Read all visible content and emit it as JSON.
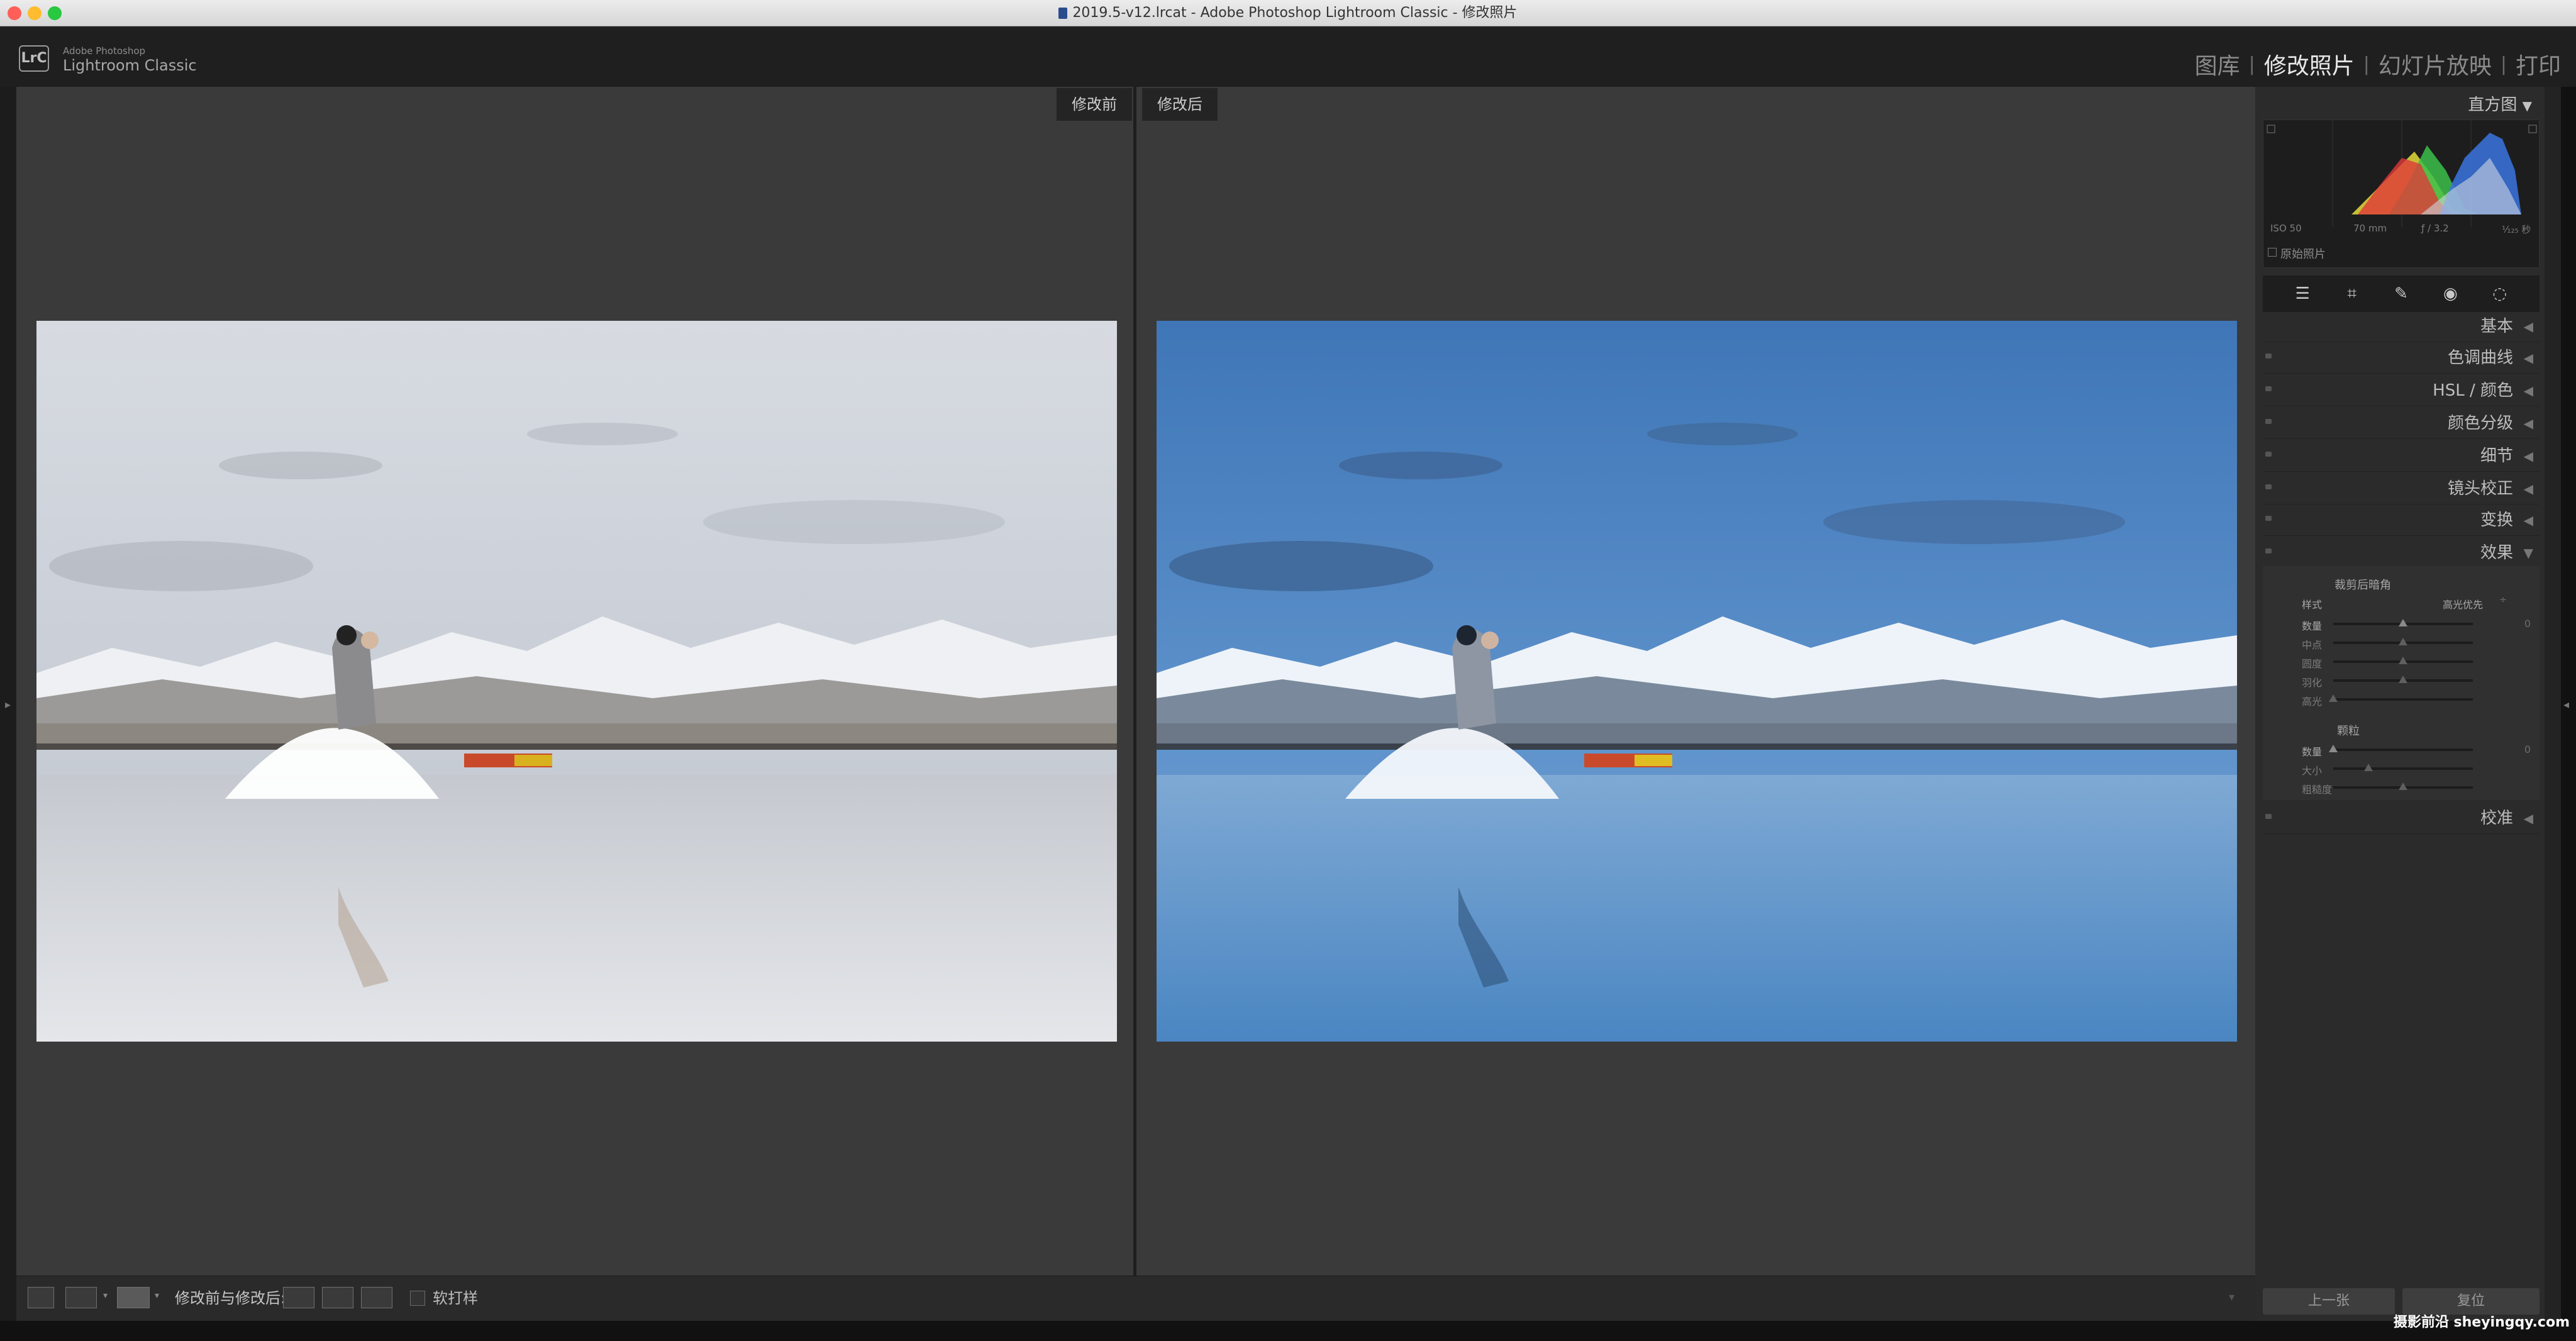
{
  "window": {
    "title": "2019.5-v12.lrcat - Adobe Photoshop Lightroom Classic - 修改照片"
  },
  "brand": {
    "logo": "LrC",
    "line1": "Adobe Photoshop",
    "line2": "Lightroom Classic"
  },
  "modules": [
    {
      "label": "图库",
      "active": false
    },
    {
      "label": "修改照片",
      "active": true
    },
    {
      "label": "幻灯片放映",
      "active": false
    },
    {
      "label": "打印",
      "active": false
    }
  ],
  "compare": {
    "before_label": "修改前",
    "after_label": "修改后"
  },
  "toolbar": {
    "ba_label": "修改前与修改后:",
    "soft_proof": "软打样"
  },
  "histogram": {
    "title": "直方图",
    "iso": "ISO 50",
    "focal": "70 mm",
    "aperture": "ƒ / 3.2",
    "shutter": "¹⁄₁₂₅ 秒",
    "original_label": "原始照片"
  },
  "sections": [
    "基本",
    "色调曲线",
    "HSL / 颜色",
    "颜色分级",
    "细节",
    "镜头校正",
    "变换",
    "效果",
    "校准"
  ],
  "effects": {
    "vignette_title": "裁剪后暗角",
    "style_label": "样式",
    "style_value": "高光优先",
    "vignette_sliders": [
      {
        "label": "数量",
        "value": "0",
        "pos": 0.5,
        "active": true
      },
      {
        "label": "中点",
        "value": "",
        "pos": 0.5,
        "active": false
      },
      {
        "label": "圆度",
        "value": "",
        "pos": 0.5,
        "active": false
      },
      {
        "label": "羽化",
        "value": "",
        "pos": 0.5,
        "active": false
      },
      {
        "label": "高光",
        "value": "",
        "pos": 0.0,
        "active": false
      }
    ],
    "grain_title": "颗粒",
    "grain_sliders": [
      {
        "label": "数量",
        "value": "0",
        "pos": 0.0,
        "active": true
      },
      {
        "label": "大小",
        "value": "",
        "pos": 0.25,
        "active": false
      },
      {
        "label": "粗糙度",
        "value": "",
        "pos": 0.5,
        "active": false
      }
    ]
  },
  "buttons": {
    "previous": "上一张",
    "reset": "复位"
  },
  "watermark": "摄影前沿 sheyingqy.com",
  "colors": {
    "accent": "#e8e8e8",
    "panel": "#2b2b2b",
    "canvas": "#3a3a3a"
  }
}
